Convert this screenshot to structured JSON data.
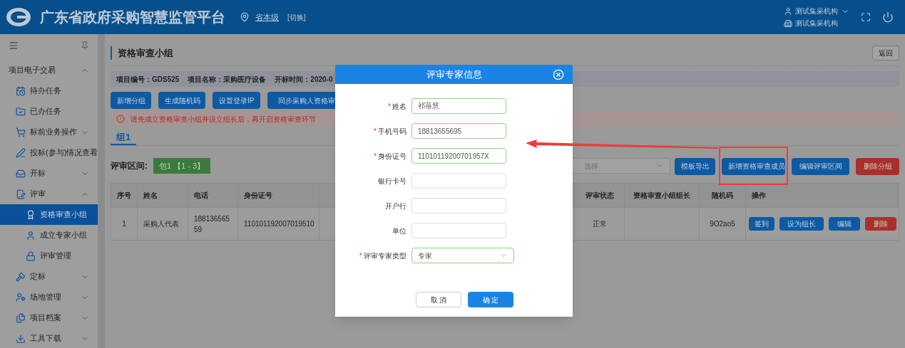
{
  "header": {
    "title": "广东省政府采购智慧监管平台",
    "location": "省本级",
    "switch_label": "[切换]",
    "user": "测试集采机构",
    "org": "测试集采机构"
  },
  "sidebar": {
    "items": [
      {
        "label": "项目电子交易",
        "kind": "section",
        "expanded": true,
        "children": [
          {
            "label": "待办任务",
            "kind": "page",
            "selected": false
          },
          {
            "label": "已办任务",
            "kind": "page",
            "selected": false
          },
          {
            "label": "标前业务操作",
            "kind": "folder",
            "expanded": false
          },
          {
            "label": "投标(参与)情况查看",
            "kind": "page",
            "selected": false
          },
          {
            "label": "开标",
            "kind": "folder",
            "expanded": false
          },
          {
            "label": "评审",
            "kind": "folder",
            "expanded": true,
            "children": [
              {
                "label": "资格审查小组",
                "kind": "page",
                "selected": true
              },
              {
                "label": "成立专家小组",
                "kind": "page",
                "selected": false
              },
              {
                "label": "评审管理",
                "kind": "page",
                "selected": false
              }
            ]
          },
          {
            "label": "定标",
            "kind": "folder",
            "expanded": false
          },
          {
            "label": "场地管理",
            "kind": "folder",
            "expanded": false
          },
          {
            "label": "项目档案",
            "kind": "folder",
            "expanded": false
          },
          {
            "label": "工具下载",
            "kind": "folder",
            "expanded": false
          }
        ]
      }
    ]
  },
  "page": {
    "title": "资格审查小组",
    "back_button": "返回",
    "info": [
      "项目编号：GDS525",
      "项目名称：采购医疗设备",
      "开标时间：2020-0"
    ],
    "toolbar": [
      "新增分组",
      "生成随机码",
      "设置登录IP",
      "同步采购人资格审"
    ],
    "alert": "请先成立资格审查小组并设立组长后，再开启资格审查环节",
    "tabs": [
      {
        "label": "组1",
        "selected": true
      }
    ],
    "range_label": "评审区间:",
    "range_badge": "包1 【1 - 3】",
    "select": {
      "placeholder": "选择"
    },
    "actions": [
      {
        "label": "模板导出",
        "kind": "primary",
        "highlighted": false
      },
      {
        "label": "新增资格审查成员",
        "kind": "primary",
        "highlighted": true
      },
      {
        "label": "编辑评审区间",
        "kind": "primary",
        "highlighted": false
      },
      {
        "label": "删除分组",
        "kind": "danger",
        "highlighted": false
      }
    ],
    "table": {
      "columns": [
        "序号",
        "姓名",
        "电话",
        "身份证号",
        "评审状态",
        "资格审查小组组长",
        "随机码",
        "操作"
      ],
      "rows": [
        {
          "cells": [
            "1",
            "采购人代表",
            "18813656559",
            "110101192007019510",
            "正常",
            "",
            "9O2ao5"
          ],
          "buttons": [
            {
              "label": "签到",
              "kind": "primary"
            },
            {
              "label": "设为组长",
              "kind": "primary"
            },
            {
              "label": "编辑",
              "kind": "primary"
            },
            {
              "label": "删除",
              "kind": "danger"
            }
          ]
        }
      ]
    }
  },
  "dialog": {
    "title": "评审专家信息",
    "fields": [
      {
        "label": "姓名",
        "required_mark": "*",
        "kind": "text",
        "value": "祁蓓慧",
        "valid": true
      },
      {
        "label": "手机号码",
        "required_mark": "*",
        "kind": "text",
        "value": "18813655695",
        "valid": true
      },
      {
        "label": "身份证号",
        "required_mark": "*",
        "kind": "text",
        "value": "11010119200701957X",
        "valid": true
      },
      {
        "label": "银行卡号",
        "kind": "text",
        "valid": false
      },
      {
        "label": "开户行",
        "kind": "text",
        "valid": false
      },
      {
        "label": "单位",
        "kind": "text",
        "valid": false
      },
      {
        "label": "评审专家类型",
        "required_mark": "*",
        "kind": "select",
        "value": "专家",
        "valid": true
      }
    ],
    "buttons": [
      {
        "label": "取 消",
        "kind": "default"
      },
      {
        "label": "确 定",
        "kind": "primary"
      }
    ]
  }
}
